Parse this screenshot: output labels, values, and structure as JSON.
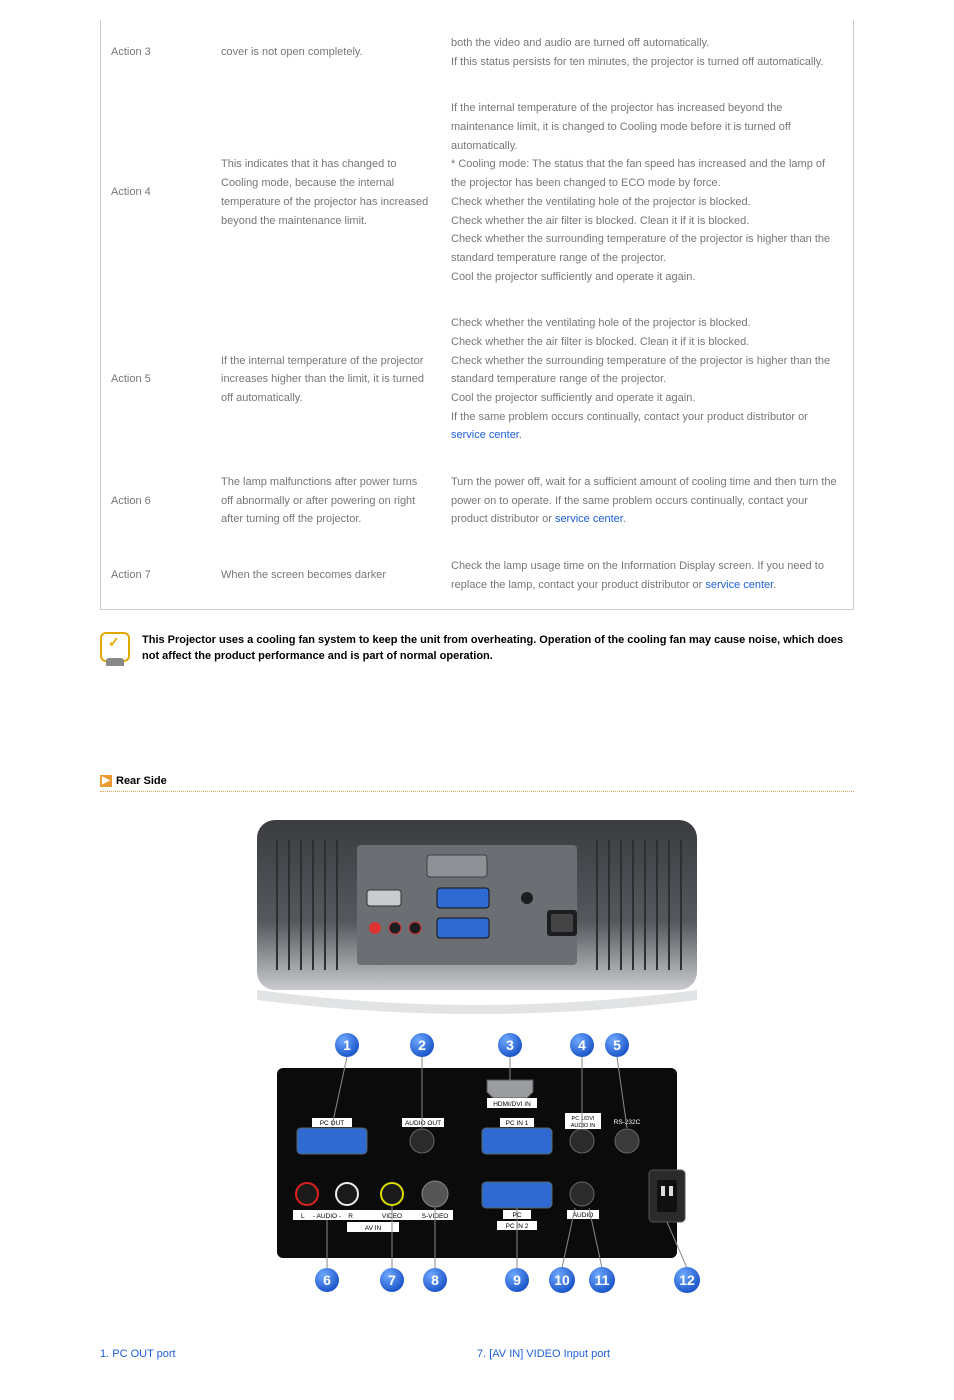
{
  "actions": {
    "row3": {
      "label": "Action 3",
      "cause": "cover is not open completely.",
      "remedy": "both the video and audio are turned off automatically.\nIf this status persists for ten minutes, the projector is turned off automatically."
    },
    "row4": {
      "label": "Action 4",
      "cause": "This indicates that it has changed to Cooling mode, because the internal temperature of the projector has increased beyond the maintenance limit.",
      "remedy": "If the internal temperature of the projector has increased beyond the maintenance limit, it is changed to Cooling mode before it is turned off automatically.\n* Cooling mode: The status that the fan speed has increased and the lamp of the projector has been changed to ECO mode by force.\nCheck whether the ventilating hole of the projector is blocked.\nCheck whether the air filter is blocked. Clean it if it is blocked.\nCheck whether the surrounding temperature of the projector is higher than the standard temperature range of the projector.\nCool the projector sufficiently and operate it again."
    },
    "row5": {
      "label": "Action 5",
      "cause": "If the internal temperature of the projector increases higher than the limit, it is turned off automatically.",
      "remedy_pre": "Check whether the ventilating hole of the projector is blocked.\nCheck whether the air filter is blocked. Clean it if it is blocked.\nCheck whether the surrounding temperature of the projector is higher than the standard temperature range of the projector.\nCool the projector sufficiently and operate it again.\nIf the same problem occurs continually, contact your product distributor or ",
      "link": "service center",
      "remedy_post": "."
    },
    "row6": {
      "label": "Action 6",
      "cause": "The lamp malfunctions after power turns off abnormally or after powering on right after turning off the projector.",
      "remedy_pre": "Turn the power off, wait for a sufficient amount of cooling time and then turn the power on to operate. If the same problem occurs continually, contact your product distributor or ",
      "link": "service center",
      "remedy_post": "."
    },
    "row7": {
      "label": "Action 7",
      "cause": "When the screen becomes darker",
      "remedy_pre": "Check the lamp usage time on the Information Display screen. If you need to replace the lamp, contact your product distributor or ",
      "link": "service center",
      "remedy_post": "."
    }
  },
  "note": "This Projector uses a cooling fan system to keep the unit from overheating. Operation of the cooling fan may cause noise, which does not affect the product performance and is part of normal operation.",
  "section_title": "Rear Side",
  "rear_labels": {
    "hdmi": "HDMI/DVI IN",
    "pcout": "PC OUT",
    "audioout": "AUDIO OUT",
    "pcin1": "PC IN 1",
    "pc1audio": "PC 1/DVI\nAUDIO IN",
    "rs232": "RS-232C",
    "audio_l": "L",
    "audio_r": "R",
    "audio_label": "- AUDIO -",
    "video": "VIDEO",
    "svideo": "S-VIDEO",
    "avin": "AV IN",
    "pc": "PC",
    "pcin2": "PC IN 2",
    "audio2": "AUDIO"
  },
  "callouts": {
    "c1": "1",
    "c2": "2",
    "c3": "3",
    "c4": "4",
    "c5": "5",
    "c6": "6",
    "c7": "7",
    "c8": "8",
    "c9": "9",
    "c10": "10",
    "c11": "11",
    "c12": "12"
  },
  "ports": {
    "left1": "1. PC OUT port",
    "right7": "7. [AV IN] VIDEO Input port"
  }
}
